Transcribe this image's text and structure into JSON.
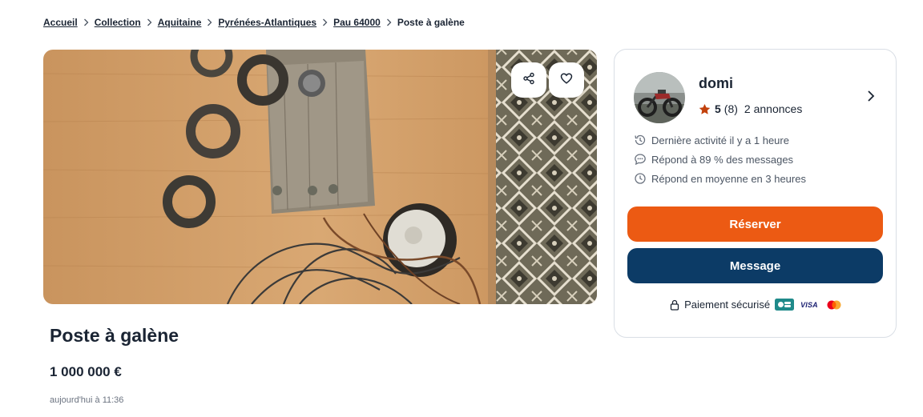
{
  "breadcrumb": {
    "items": [
      "Accueil",
      "Collection",
      "Aquitaine",
      "Pyrénées-Atlantiques",
      "Pau 64000"
    ],
    "current": "Poste à galène"
  },
  "listing": {
    "title": "Poste à galène",
    "price": "1 000 000 €",
    "date": "aujourd'hui à 11:36"
  },
  "seller": {
    "name": "domi",
    "rating": "5",
    "rating_count": "(8)",
    "listings": "2 annonces",
    "last_activity": "Dernière activité il y a 1 heure",
    "response_rate": "Répond à 89 % des messages",
    "response_time": "Répond en moyenne en 3 heures"
  },
  "actions": {
    "reserve": "Réserver",
    "message": "Message"
  },
  "payment": {
    "label": "Paiement sécurisé",
    "visa": "VISA"
  },
  "colors": {
    "accent_orange": "#ec5a13",
    "primary_blue": "#0c3b66",
    "star": "#c2410c"
  },
  "icons": [
    "chevron-right-icon",
    "share-icon",
    "heart-icon",
    "star-icon",
    "history-icon",
    "chat-bubble-icon",
    "clock-icon",
    "lock-icon",
    "cb-card-icon",
    "mastercard-icon"
  ]
}
